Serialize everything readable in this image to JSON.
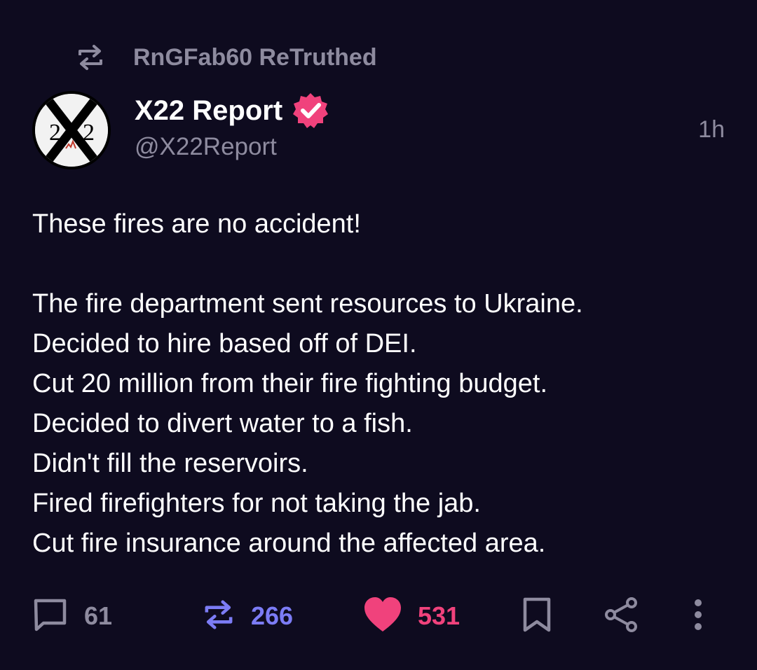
{
  "retruth": {
    "label": "RnGFab60 ReTruthed",
    "icon": "retruth-icon"
  },
  "author": {
    "display_name": "X22 Report",
    "handle": "@X22Report",
    "verified": true,
    "avatar_text": "X22"
  },
  "timestamp": "1h",
  "post": {
    "lines": [
      "These fires are no accident!",
      "",
      "The fire department sent resources to Ukraine.",
      "Decided to hire based off of DEI.",
      "Cut 20 million from their fire fighting budget.",
      "Decided to divert water to a fish.",
      "Didn't fill the reservoirs.",
      "Fired firefighters for not taking the jab.",
      "Cut fire insurance around the affected area."
    ]
  },
  "actions": {
    "replies": "61",
    "retruths": "266",
    "likes": "531"
  },
  "colors": {
    "background": "#0e0b1f",
    "muted": "#8e8b9f",
    "retruth_accent": "#7c7cf5",
    "like_accent": "#f0427c",
    "verified_badge": "#f0427c"
  }
}
